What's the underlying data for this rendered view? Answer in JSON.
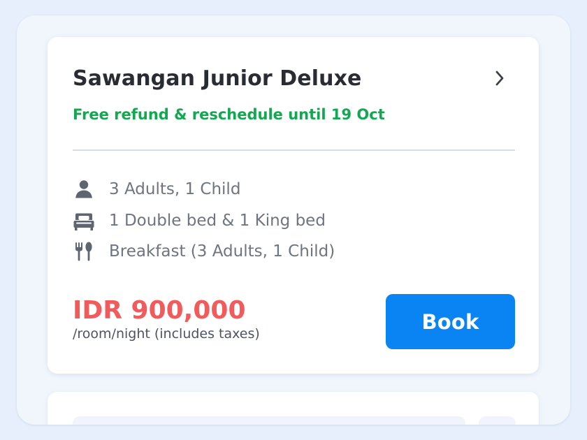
{
  "room": {
    "title": "Sawangan Junior Deluxe",
    "refund_policy": "Free refund & reschedule until 19 Oct",
    "features": {
      "guests": {
        "icon": "person-icon",
        "label": "3 Adults, 1 Child"
      },
      "beds": {
        "icon": "bed-icon",
        "label": "1 Double bed & 1 King bed"
      },
      "meals": {
        "icon": "fork-spoon-icon",
        "label": "Breakfast (3 Adults, 1 Child)"
      }
    },
    "price": {
      "amount": "IDR 900,000",
      "note": "/room/night (includes taxes)"
    },
    "book_label": "Book"
  },
  "colors": {
    "title": "#2A2C33",
    "refund": "#11A850",
    "price": "#F15B5B",
    "button": "#0A84F2",
    "feature_text": "#6E7480",
    "icon": "#5E6470"
  },
  "icons": {
    "details": "chevron-right-icon"
  }
}
